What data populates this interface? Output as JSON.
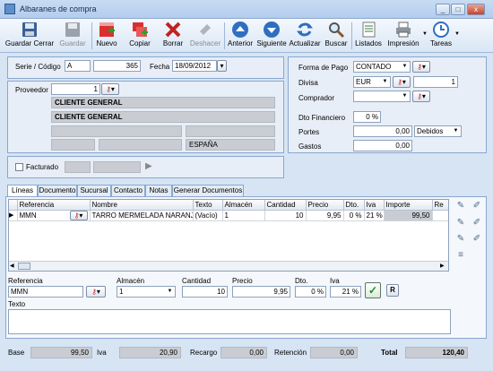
{
  "window": {
    "title": "Albaranes de compra"
  },
  "toolbar": {
    "buttons": [
      {
        "label": "Guardar Cerrar",
        "icon": "save-close-icon"
      },
      {
        "label": "Guardar",
        "icon": "save-icon"
      },
      {
        "label": "Nuevo",
        "icon": "new-icon"
      },
      {
        "label": "Copiar",
        "icon": "copy-icon"
      },
      {
        "label": "Borrar",
        "icon": "delete-icon"
      },
      {
        "label": "Deshacer",
        "icon": "undo-icon"
      },
      {
        "label": "Anterior",
        "icon": "previous-icon"
      },
      {
        "label": "Siguiente",
        "icon": "next-icon"
      },
      {
        "label": "Actualizar",
        "icon": "refresh-icon"
      },
      {
        "label": "Buscar",
        "icon": "search-icon"
      },
      {
        "label": "Listados",
        "icon": "reports-icon"
      },
      {
        "label": "Impresión",
        "icon": "print-icon"
      },
      {
        "label": "Tareas",
        "icon": "tasks-icon"
      }
    ]
  },
  "header": {
    "serie_label": "Serie / Código",
    "serie": "A",
    "codigo": "365",
    "fecha_label": "Fecha",
    "fecha": "18/09/2012",
    "proveedor_label": "Proveedor",
    "proveedor_code": "1",
    "proveedor_name1": "CLIENTE GENERAL",
    "proveedor_name2": "CLIENTE GENERAL",
    "pais": "ESPAÑA",
    "facturado_label": "Facturado"
  },
  "payment": {
    "forma_pago_label": "Forma de Pago",
    "forma_pago": "CONTADO",
    "divisa_label": "Divisa",
    "divisa": "EUR",
    "divisa_rate": "1",
    "comprador_label": "Comprador",
    "comprador": "",
    "dto_label": "Dto Financiero",
    "dto": "0 %",
    "portes_label": "Portes",
    "portes": "0,00",
    "portes_tipo": "Debidos",
    "gastos_label": "Gastos",
    "gastos": "0,00"
  },
  "tabs": [
    "Líneas",
    "Documento",
    "Sucursal",
    "Contacto",
    "Notas",
    "Generar Documentos"
  ],
  "lines": {
    "columns": [
      "Referencia",
      "Nombre",
      "Texto",
      "Almacén",
      "Cantidad",
      "Precio",
      "Dto.",
      "Iva",
      "Importe",
      "Re"
    ],
    "rows": [
      [
        "MMN",
        "TARRO MERMELADA NARANJA",
        "(Vacío)",
        "1",
        "10",
        "9,95",
        "0 %",
        "21 %",
        "99,50",
        ""
      ]
    ]
  },
  "editor": {
    "ref_label": "Referencia",
    "ref": "MMN",
    "almacen_label": "Almacén",
    "almacen": "1",
    "cantidad_label": "Cantidad",
    "cantidad": "10",
    "precio_label": "Precio",
    "precio": "9,95",
    "dto_label": "Dto.",
    "dto": "0 %",
    "iva_label": "Iva",
    "iva": "21 %",
    "r_button": "R",
    "texto_label": "Texto"
  },
  "totals": {
    "base_label": "Base",
    "base": "99,50",
    "iva_label": "Iva",
    "iva": "20,90",
    "recargo_label": "Recargo",
    "recargo": "0,00",
    "retencion_label": "Retención",
    "retencion": "0,00",
    "total_label": "Total",
    "total": "120,40"
  }
}
